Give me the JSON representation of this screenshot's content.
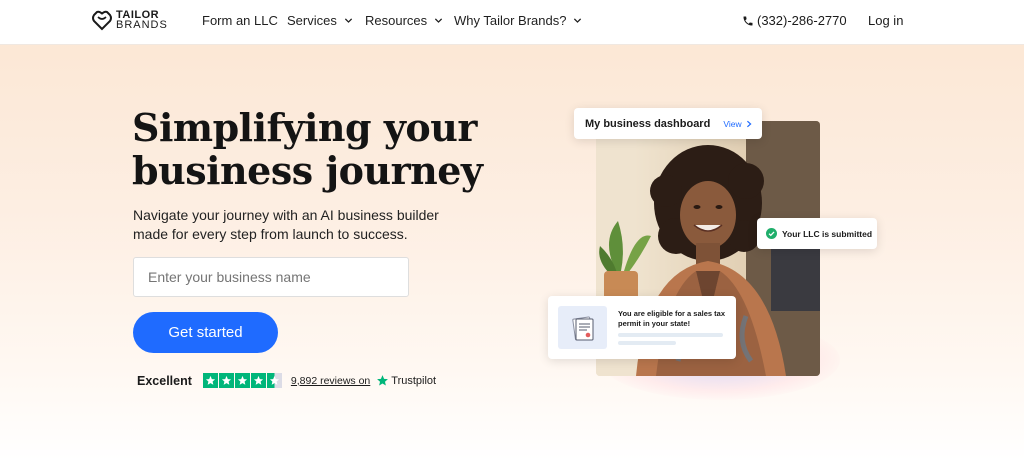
{
  "header": {
    "logo_line1": "TAILOR",
    "logo_line2": "BRANDS",
    "nav": [
      {
        "label": "Form an LLC",
        "has_dropdown": false
      },
      {
        "label": "Services",
        "has_dropdown": true
      },
      {
        "label": "Resources",
        "has_dropdown": true
      },
      {
        "label": "Why Tailor Brands?",
        "has_dropdown": true
      }
    ],
    "phone": "(332)-286-2770",
    "login": "Log in"
  },
  "hero": {
    "title": "Simplifying your business journey",
    "subtitle": "Navigate your journey with an AI business builder made for every step from launch to success.",
    "input_placeholder": "Enter your business name",
    "input_value": "",
    "cta_label": "Get started"
  },
  "rating": {
    "label": "Excellent",
    "stars": 4.5,
    "reviews_link": "9,892 reviews on",
    "provider": "Trustpilot"
  },
  "illustration": {
    "dashboard_title": "My business dashboard",
    "dashboard_view": "View",
    "llc_status": "Your LLC is submitted",
    "tax_message": "You are eligible for a sales tax permit in your state!"
  },
  "colors": {
    "accent": "#1f6bff",
    "trustpilot_green": "#00b67a",
    "hero_bg_top": "#fbe6d2",
    "success_green": "#1fae6b"
  },
  "icons": {
    "logo": "tailor-brands-logo-icon",
    "phone": "phone-icon",
    "chevron": "chevron-down-icon",
    "star": "star-icon",
    "check": "check-circle-icon",
    "document": "certificate-document-icon"
  }
}
